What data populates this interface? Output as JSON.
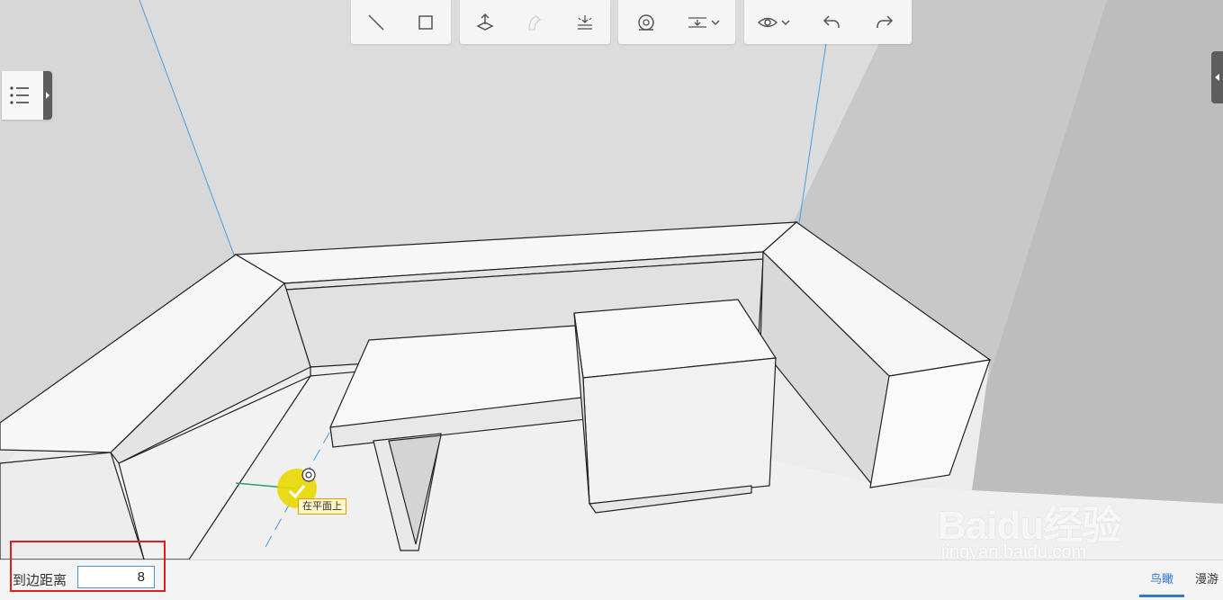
{
  "toolbar": {
    "groups": [
      {
        "items": [
          {
            "icon": "line-tool-icon"
          },
          {
            "icon": "rectangle-tool-icon"
          }
        ]
      },
      {
        "items": [
          {
            "icon": "push-pull-icon"
          },
          {
            "icon": "follow-me-icon"
          },
          {
            "icon": "offset-icon"
          }
        ]
      },
      {
        "items": [
          {
            "icon": "tape-measure-icon"
          },
          {
            "icon": "align-dropdown-icon"
          }
        ]
      },
      {
        "items": [
          {
            "icon": "view-eye-icon"
          },
          {
            "icon": "undo-icon"
          },
          {
            "icon": "redo-icon"
          }
        ]
      }
    ]
  },
  "left_panel": {
    "icon": "list-menu-icon"
  },
  "snap_tooltip": "在平面上",
  "status_bar": {
    "distance_label": "到边距离",
    "distance_value": "8"
  },
  "view_tabs": [
    {
      "label": "鸟瞰",
      "active": true
    },
    {
      "label": "漫游",
      "active": false
    }
  ],
  "watermark": {
    "logo": "Baidu经验",
    "url": "jingyan.baidu.com"
  },
  "colors": {
    "accent": "#2f78d6",
    "highlight_box": "#e02020",
    "guide_line": "#4a9be0",
    "snap_marker": "#e8d800"
  }
}
